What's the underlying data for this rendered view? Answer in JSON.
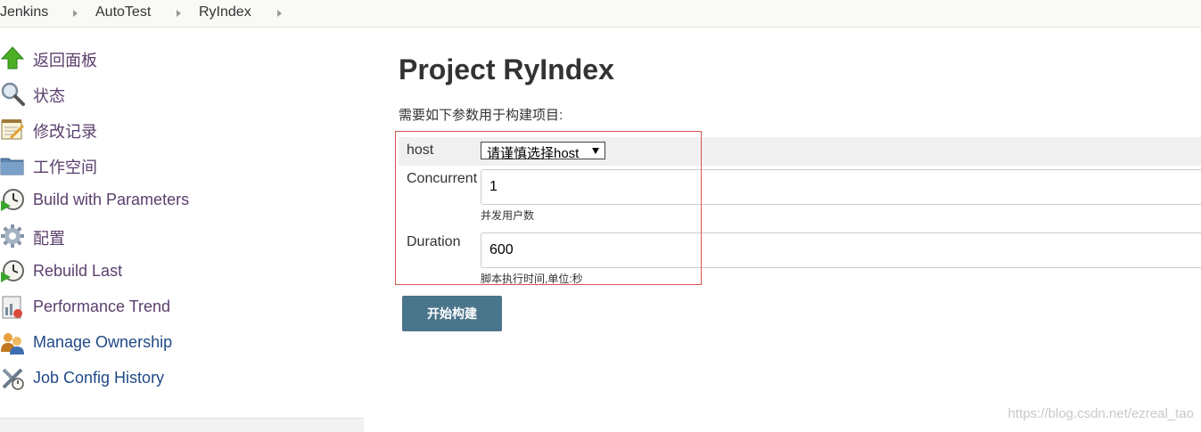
{
  "breadcrumb": {
    "items": [
      "Jenkins",
      "AutoTest",
      "RyIndex"
    ]
  },
  "sidebar": {
    "items": [
      {
        "label": "返回面板",
        "icon": "up-arrow-icon"
      },
      {
        "label": "状态",
        "icon": "magnifier-icon"
      },
      {
        "label": "修改记录",
        "icon": "notepad-icon"
      },
      {
        "label": "工作空间",
        "icon": "folder-icon"
      },
      {
        "label": "Build with Parameters",
        "icon": "clock-play-icon"
      },
      {
        "label": "配置",
        "icon": "gear-icon"
      },
      {
        "label": "Rebuild Last",
        "icon": "clock-play-icon"
      },
      {
        "label": "Performance Trend",
        "icon": "chart-icon"
      },
      {
        "label": "Manage Ownership",
        "icon": "users-icon"
      },
      {
        "label": "Job Config History",
        "icon": "tools-icon"
      }
    ]
  },
  "main": {
    "title": "Project RyIndex",
    "subtitle": "需要如下参数用于构建项目:",
    "params": {
      "host": {
        "label": "host",
        "selected": "请谨慎选择host"
      },
      "concurrent": {
        "label": "Concurrent",
        "value": "1",
        "description": "并发用户数"
      },
      "duration": {
        "label": "Duration",
        "value": "600",
        "description": "脚本执行时间,单位:秒"
      }
    },
    "build_button": "开始构建"
  },
  "watermark": "https://blog.csdn.net/ezreal_tao",
  "colors": {
    "build_button": "#4b758b",
    "highlight_border": "#d9534f",
    "sidebar_link": "#5a3f6d"
  }
}
